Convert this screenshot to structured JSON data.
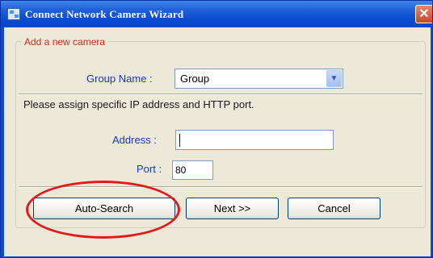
{
  "window": {
    "title": "Connect Network Camera Wizard",
    "close_icon": "close-icon"
  },
  "group_box": {
    "legend": "Add a new camera"
  },
  "group_name": {
    "label": "Group Name :",
    "value": "Group"
  },
  "instruction": "Please assign specific IP address and HTTP port.",
  "address": {
    "label": "Address :",
    "value": ""
  },
  "port": {
    "label": "Port :",
    "value": "80"
  },
  "buttons": {
    "auto_search": "Auto-Search",
    "next": "Next >>",
    "cancel": "Cancel"
  },
  "colors": {
    "titlebar": "#0a4ad0",
    "label_blue": "#1c36c7",
    "legend_red": "#c72b22",
    "annotation": "#e01b1b",
    "dialog_bg": "#ece9d8"
  }
}
